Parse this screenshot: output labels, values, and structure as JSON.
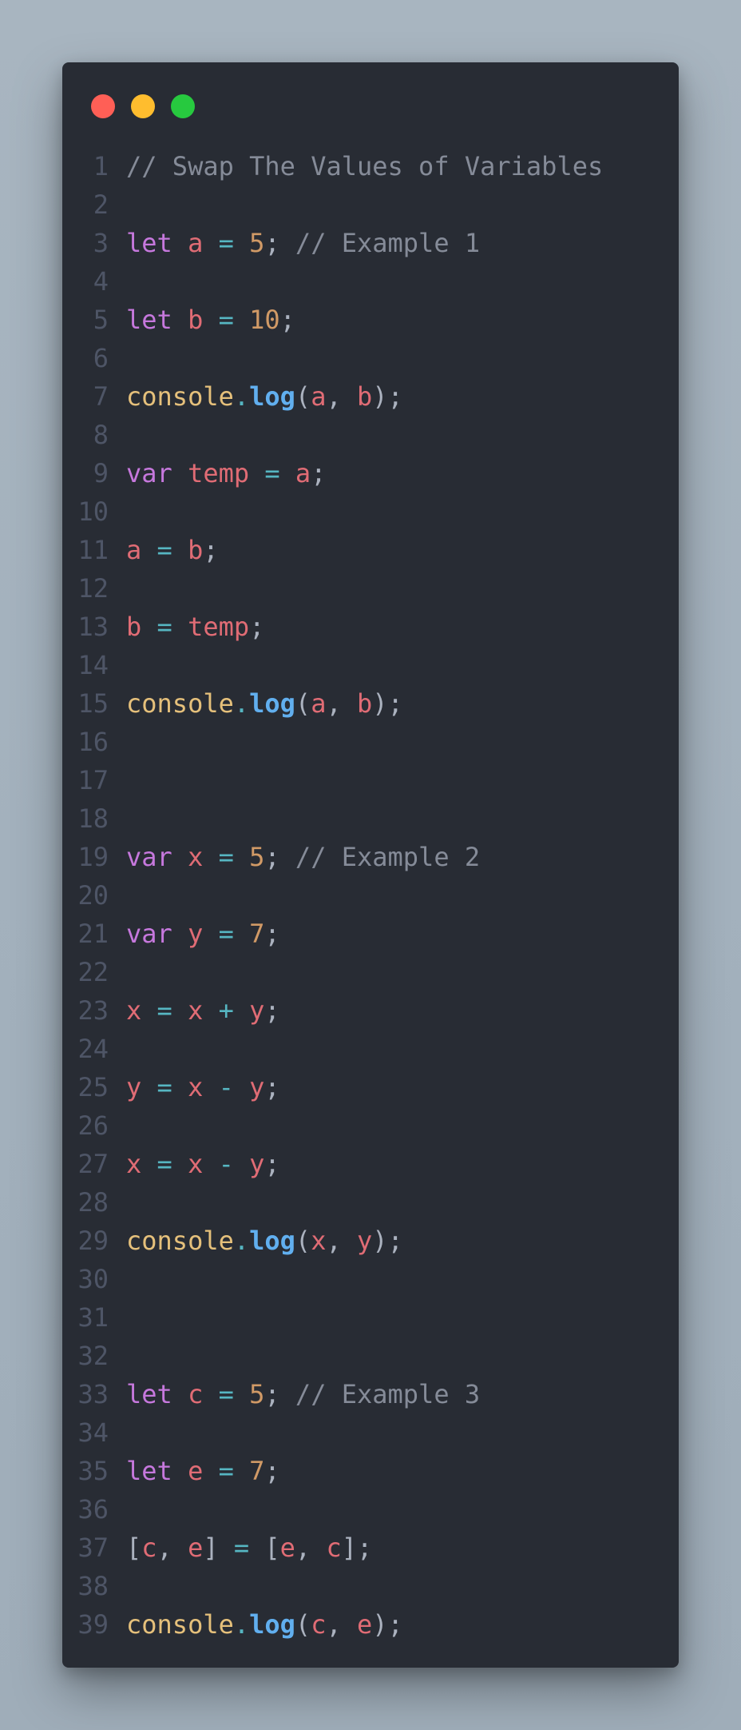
{
  "window": {
    "dots": [
      {
        "name": "close-dot",
        "color": "#ff5f56"
      },
      {
        "name": "minimize-dot",
        "color": "#ffbd2e"
      },
      {
        "name": "maximize-dot",
        "color": "#27c93f"
      }
    ]
  },
  "colors": {
    "comment": "#858b98",
    "keyword": "#c678dd",
    "variable": "#e06c75",
    "operator": "#56b6c2",
    "number": "#d19a66",
    "object": "#e5c07b",
    "function": "#61afef",
    "punctuation": "#abb2bf",
    "line_number": "#4e5566",
    "background": "#282c34"
  },
  "code": {
    "lines": [
      {
        "n": "1",
        "tokens": [
          {
            "t": "comment",
            "v": "// Swap The Values of Variables"
          }
        ]
      },
      {
        "n": "2",
        "tokens": []
      },
      {
        "n": "3",
        "tokens": [
          {
            "t": "keyword",
            "v": "let"
          },
          {
            "t": "space",
            "v": " "
          },
          {
            "t": "var",
            "v": "a"
          },
          {
            "t": "space",
            "v": " "
          },
          {
            "t": "op",
            "v": "="
          },
          {
            "t": "space",
            "v": " "
          },
          {
            "t": "num",
            "v": "5"
          },
          {
            "t": "punc",
            "v": ";"
          },
          {
            "t": "space",
            "v": " "
          },
          {
            "t": "comment",
            "v": "// Example 1"
          }
        ]
      },
      {
        "n": "4",
        "tokens": []
      },
      {
        "n": "5",
        "tokens": [
          {
            "t": "keyword",
            "v": "let"
          },
          {
            "t": "space",
            "v": " "
          },
          {
            "t": "var",
            "v": "b"
          },
          {
            "t": "space",
            "v": " "
          },
          {
            "t": "op",
            "v": "="
          },
          {
            "t": "space",
            "v": " "
          },
          {
            "t": "num",
            "v": "10"
          },
          {
            "t": "punc",
            "v": ";"
          }
        ]
      },
      {
        "n": "6",
        "tokens": []
      },
      {
        "n": "7",
        "tokens": [
          {
            "t": "obj",
            "v": "console"
          },
          {
            "t": "op",
            "v": "."
          },
          {
            "t": "fn",
            "v": "log"
          },
          {
            "t": "punc",
            "v": "("
          },
          {
            "t": "var",
            "v": "a"
          },
          {
            "t": "punc",
            "v": ", "
          },
          {
            "t": "var",
            "v": "b"
          },
          {
            "t": "punc",
            "v": ");"
          }
        ]
      },
      {
        "n": "8",
        "tokens": []
      },
      {
        "n": "9",
        "tokens": [
          {
            "t": "keyword",
            "v": "var"
          },
          {
            "t": "space",
            "v": " "
          },
          {
            "t": "var",
            "v": "temp"
          },
          {
            "t": "space",
            "v": " "
          },
          {
            "t": "op",
            "v": "="
          },
          {
            "t": "space",
            "v": " "
          },
          {
            "t": "var",
            "v": "a"
          },
          {
            "t": "punc",
            "v": ";"
          }
        ]
      },
      {
        "n": "10",
        "tokens": []
      },
      {
        "n": "11",
        "tokens": [
          {
            "t": "var",
            "v": "a"
          },
          {
            "t": "space",
            "v": " "
          },
          {
            "t": "op",
            "v": "="
          },
          {
            "t": "space",
            "v": " "
          },
          {
            "t": "var",
            "v": "b"
          },
          {
            "t": "punc",
            "v": ";"
          }
        ]
      },
      {
        "n": "12",
        "tokens": []
      },
      {
        "n": "13",
        "tokens": [
          {
            "t": "var",
            "v": "b"
          },
          {
            "t": "space",
            "v": " "
          },
          {
            "t": "op",
            "v": "="
          },
          {
            "t": "space",
            "v": " "
          },
          {
            "t": "var",
            "v": "temp"
          },
          {
            "t": "punc",
            "v": ";"
          }
        ]
      },
      {
        "n": "14",
        "tokens": []
      },
      {
        "n": "15",
        "tokens": [
          {
            "t": "obj",
            "v": "console"
          },
          {
            "t": "op",
            "v": "."
          },
          {
            "t": "fn",
            "v": "log"
          },
          {
            "t": "punc",
            "v": "("
          },
          {
            "t": "var",
            "v": "a"
          },
          {
            "t": "punc",
            "v": ", "
          },
          {
            "t": "var",
            "v": "b"
          },
          {
            "t": "punc",
            "v": ");"
          }
        ]
      },
      {
        "n": "16",
        "tokens": []
      },
      {
        "n": "17",
        "tokens": []
      },
      {
        "n": "18",
        "tokens": []
      },
      {
        "n": "19",
        "tokens": [
          {
            "t": "keyword",
            "v": "var"
          },
          {
            "t": "space",
            "v": " "
          },
          {
            "t": "var",
            "v": "x"
          },
          {
            "t": "space",
            "v": " "
          },
          {
            "t": "op",
            "v": "="
          },
          {
            "t": "space",
            "v": " "
          },
          {
            "t": "num",
            "v": "5"
          },
          {
            "t": "punc",
            "v": ";"
          },
          {
            "t": "space",
            "v": " "
          },
          {
            "t": "comment",
            "v": "// Example 2"
          }
        ]
      },
      {
        "n": "20",
        "tokens": []
      },
      {
        "n": "21",
        "tokens": [
          {
            "t": "keyword",
            "v": "var"
          },
          {
            "t": "space",
            "v": " "
          },
          {
            "t": "var",
            "v": "y"
          },
          {
            "t": "space",
            "v": " "
          },
          {
            "t": "op",
            "v": "="
          },
          {
            "t": "space",
            "v": " "
          },
          {
            "t": "num",
            "v": "7"
          },
          {
            "t": "punc",
            "v": ";"
          }
        ]
      },
      {
        "n": "22",
        "tokens": []
      },
      {
        "n": "23",
        "tokens": [
          {
            "t": "var",
            "v": "x"
          },
          {
            "t": "space",
            "v": " "
          },
          {
            "t": "op",
            "v": "="
          },
          {
            "t": "space",
            "v": " "
          },
          {
            "t": "var",
            "v": "x"
          },
          {
            "t": "space",
            "v": " "
          },
          {
            "t": "op",
            "v": "+"
          },
          {
            "t": "space",
            "v": " "
          },
          {
            "t": "var",
            "v": "y"
          },
          {
            "t": "punc",
            "v": ";"
          }
        ]
      },
      {
        "n": "24",
        "tokens": []
      },
      {
        "n": "25",
        "tokens": [
          {
            "t": "var",
            "v": "y"
          },
          {
            "t": "space",
            "v": " "
          },
          {
            "t": "op",
            "v": "="
          },
          {
            "t": "space",
            "v": " "
          },
          {
            "t": "var",
            "v": "x"
          },
          {
            "t": "space",
            "v": " "
          },
          {
            "t": "op",
            "v": "-"
          },
          {
            "t": "space",
            "v": " "
          },
          {
            "t": "var",
            "v": "y"
          },
          {
            "t": "punc",
            "v": ";"
          }
        ]
      },
      {
        "n": "26",
        "tokens": []
      },
      {
        "n": "27",
        "tokens": [
          {
            "t": "var",
            "v": "x"
          },
          {
            "t": "space",
            "v": " "
          },
          {
            "t": "op",
            "v": "="
          },
          {
            "t": "space",
            "v": " "
          },
          {
            "t": "var",
            "v": "x"
          },
          {
            "t": "space",
            "v": " "
          },
          {
            "t": "op",
            "v": "-"
          },
          {
            "t": "space",
            "v": " "
          },
          {
            "t": "var",
            "v": "y"
          },
          {
            "t": "punc",
            "v": ";"
          }
        ]
      },
      {
        "n": "28",
        "tokens": []
      },
      {
        "n": "29",
        "tokens": [
          {
            "t": "obj",
            "v": "console"
          },
          {
            "t": "op",
            "v": "."
          },
          {
            "t": "fn",
            "v": "log"
          },
          {
            "t": "punc",
            "v": "("
          },
          {
            "t": "var",
            "v": "x"
          },
          {
            "t": "punc",
            "v": ", "
          },
          {
            "t": "var",
            "v": "y"
          },
          {
            "t": "punc",
            "v": ");"
          }
        ]
      },
      {
        "n": "30",
        "tokens": []
      },
      {
        "n": "31",
        "tokens": []
      },
      {
        "n": "32",
        "tokens": []
      },
      {
        "n": "33",
        "tokens": [
          {
            "t": "keyword",
            "v": "let"
          },
          {
            "t": "space",
            "v": " "
          },
          {
            "t": "var",
            "v": "c"
          },
          {
            "t": "space",
            "v": " "
          },
          {
            "t": "op",
            "v": "="
          },
          {
            "t": "space",
            "v": " "
          },
          {
            "t": "num",
            "v": "5"
          },
          {
            "t": "punc",
            "v": ";"
          },
          {
            "t": "space",
            "v": " "
          },
          {
            "t": "comment",
            "v": "// Example 3"
          }
        ]
      },
      {
        "n": "34",
        "tokens": []
      },
      {
        "n": "35",
        "tokens": [
          {
            "t": "keyword",
            "v": "let"
          },
          {
            "t": "space",
            "v": " "
          },
          {
            "t": "var",
            "v": "e"
          },
          {
            "t": "space",
            "v": " "
          },
          {
            "t": "op",
            "v": "="
          },
          {
            "t": "space",
            "v": " "
          },
          {
            "t": "num",
            "v": "7"
          },
          {
            "t": "punc",
            "v": ";"
          }
        ]
      },
      {
        "n": "36",
        "tokens": []
      },
      {
        "n": "37",
        "tokens": [
          {
            "t": "punc",
            "v": "["
          },
          {
            "t": "var",
            "v": "c"
          },
          {
            "t": "punc",
            "v": ", "
          },
          {
            "t": "var",
            "v": "e"
          },
          {
            "t": "punc",
            "v": "]"
          },
          {
            "t": "space",
            "v": " "
          },
          {
            "t": "op",
            "v": "="
          },
          {
            "t": "space",
            "v": " "
          },
          {
            "t": "punc",
            "v": "["
          },
          {
            "t": "var",
            "v": "e"
          },
          {
            "t": "punc",
            "v": ", "
          },
          {
            "t": "var",
            "v": "c"
          },
          {
            "t": "punc",
            "v": "];"
          }
        ]
      },
      {
        "n": "38",
        "tokens": []
      },
      {
        "n": "39",
        "tokens": [
          {
            "t": "obj",
            "v": "console"
          },
          {
            "t": "op",
            "v": "."
          },
          {
            "t": "fn",
            "v": "log"
          },
          {
            "t": "punc",
            "v": "("
          },
          {
            "t": "var",
            "v": "c"
          },
          {
            "t": "punc",
            "v": ", "
          },
          {
            "t": "var",
            "v": "e"
          },
          {
            "t": "punc",
            "v": ");"
          }
        ]
      }
    ]
  }
}
